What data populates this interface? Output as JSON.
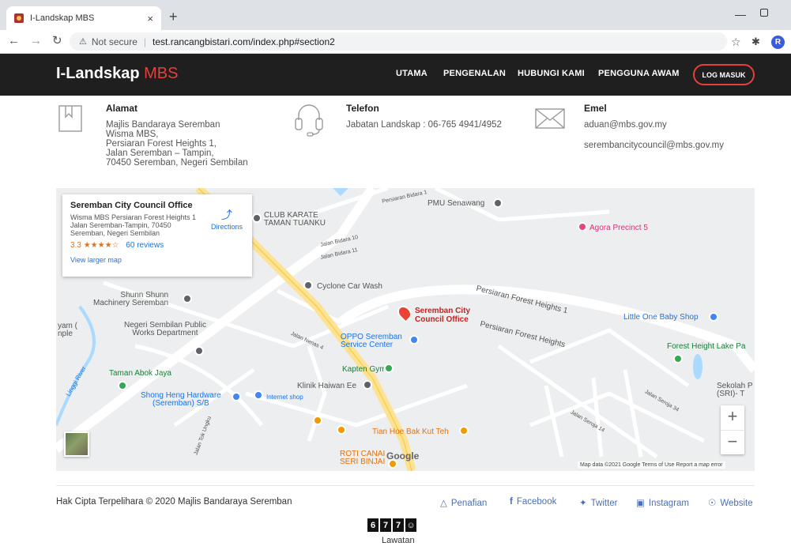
{
  "browser": {
    "tab_title": "I-Landskap MBS",
    "tab_close": "×",
    "new_tab": "+",
    "not_secure": "Not secure",
    "url": "test.rancangbistari.com/index.php#section2",
    "profile_initial": "R"
  },
  "site": {
    "brand": "I-Landskap",
    "brand_accent": "MBS",
    "nav": [
      "UTAMA",
      "PENGENALAN",
      "HUBUNGI KAMI",
      "PENGGUNA AWAM"
    ],
    "login": "LOG MASUK"
  },
  "contact": {
    "address": {
      "title": "Alamat",
      "lines": [
        "Majlis Bandaraya Seremban",
        "Wisma MBS,",
        "Persiaran Forest Heights 1,",
        "Jalan Seremban – Tampin,",
        "70450 Seremban, Negeri Sembilan"
      ]
    },
    "phone": {
      "title": "Telefon",
      "text": "Jabatan Landskap : 06-765 4941/4952"
    },
    "email": {
      "title": "Emel",
      "lines": [
        "aduan@mbs.gov.my",
        "serembancitycouncil@mbs.gov.my"
      ]
    }
  },
  "map": {
    "card": {
      "title": "Seremban City Council Office",
      "address": "Wisma MBS Persiaran Forest Heights 1 Jalan Seremban-Tampin, 70450 Seremban, Negeri Sembilan",
      "rating": "3.3",
      "stars": "★★★★☆",
      "reviews": "60 reviews",
      "directions": "Directions",
      "view_larger": "View larger map"
    },
    "labels": {
      "club_karate": "CLUB KARATE\nTAMAN TUANKU",
      "pmu": "PMU Senawang",
      "agora": "Agora Precinct 5",
      "cyclone": "Cyclone Car Wash",
      "shunn": "Shunn Shunn\nMachinery Seremban",
      "seremban_council": "Seremban City\nCouncil Office",
      "forest_heights_1": "Persiaran Forest Heights 1",
      "little_one": "Little One Baby Shop",
      "negeri_works": "Negeri Sembilan Public\nWorks Department",
      "oppo": "OPPO Seremban\nService Center",
      "forest_height_lake": "Forest Height Lake Pa",
      "kapten_gym": "Kapten Gym",
      "taman_abok": "Taman Abok Jaya",
      "klinik": "Klinik Haiwan Ee",
      "shong_heng": "Shong Heng Hardware\n(Seremban) S/B",
      "internet_shop": "Internet shop",
      "tian_hoe": "Tian Hoe Bak Kut Teh",
      "roti_canai": "ROTI CANAI\nSERI BINJAI",
      "sekolah": "Sekolah P\n(SRI)- T",
      "persiaran_forest_heights": "Persiaran Forest Heights",
      "jalan_bidara_1": "Persiaran Bidara 1",
      "jalan_tok_ungku": "Jalan Tok Ungku",
      "jalan_nenas": "Jalan Nenas 4",
      "jalan_bidara_10": "Jalan Bidara 10",
      "jalan_bidara_11": "Jalan Bidara 11",
      "jalan_seroja_34": "Jalan Seroja 34",
      "jalan_seroja_14": "Jalan Seroja 14",
      "yam": "yam (\nnple",
      "linggi": "Linggi River",
      "google": "Google"
    },
    "attribution": "Map data ©2021 Google   Terms of Use   Report a map error",
    "zoom_in": "+",
    "zoom_out": "−"
  },
  "footer": {
    "copyright": "Hak Cipta Terpelihara © 2020 Majlis Bandaraya Seremban",
    "links": [
      "Penafian",
      "Facebook",
      "Twitter",
      "Instagram",
      "Website"
    ],
    "counter_digits": [
      "6",
      "7",
      "7",
      "☺"
    ],
    "counter_label": "Lawatan"
  }
}
